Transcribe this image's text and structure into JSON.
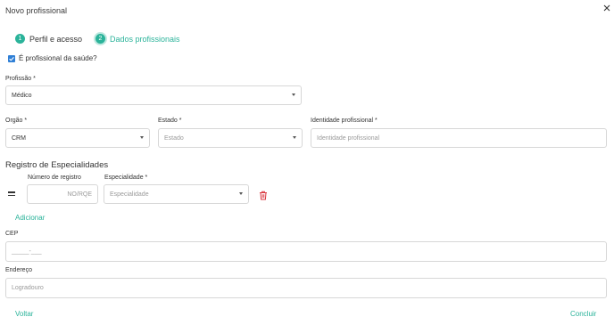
{
  "dialog": {
    "title": "Novo profissional",
    "close_icon": "close-icon"
  },
  "stepper": {
    "steps": [
      {
        "number": "1",
        "label": "Perfil e acesso",
        "state": "done"
      },
      {
        "number": "2",
        "label": "Dados profissionais",
        "state": "active"
      }
    ]
  },
  "health_professional": {
    "label": "É profissional da saúde?",
    "checked": true
  },
  "profession": {
    "label": "Profissão *",
    "value": "Médico"
  },
  "organ": {
    "label": "Orgão *",
    "value": "CRM"
  },
  "state": {
    "label": "Estado *",
    "placeholder": "Estado"
  },
  "professional_id": {
    "label": "Identidade profissional *",
    "placeholder": "Identidade profissional"
  },
  "specialties": {
    "title": "Registro de Especialidades",
    "registration_label": "Número de registro",
    "registration_placeholder": "NO/RQE",
    "specialty_label": "Especialidade *",
    "specialty_placeholder": "Especialidade",
    "add_label": "Adicionar"
  },
  "cep": {
    "label": "CEP",
    "placeholder": "_____-___"
  },
  "address": {
    "label": "Endereço",
    "placeholder": "Logradouro"
  },
  "footer": {
    "back_label": "Voltar",
    "finish_label": "Concluir"
  },
  "colors": {
    "accent": "#2bb39a",
    "checkbox": "#2f7fd6",
    "danger": "#d9363e"
  }
}
